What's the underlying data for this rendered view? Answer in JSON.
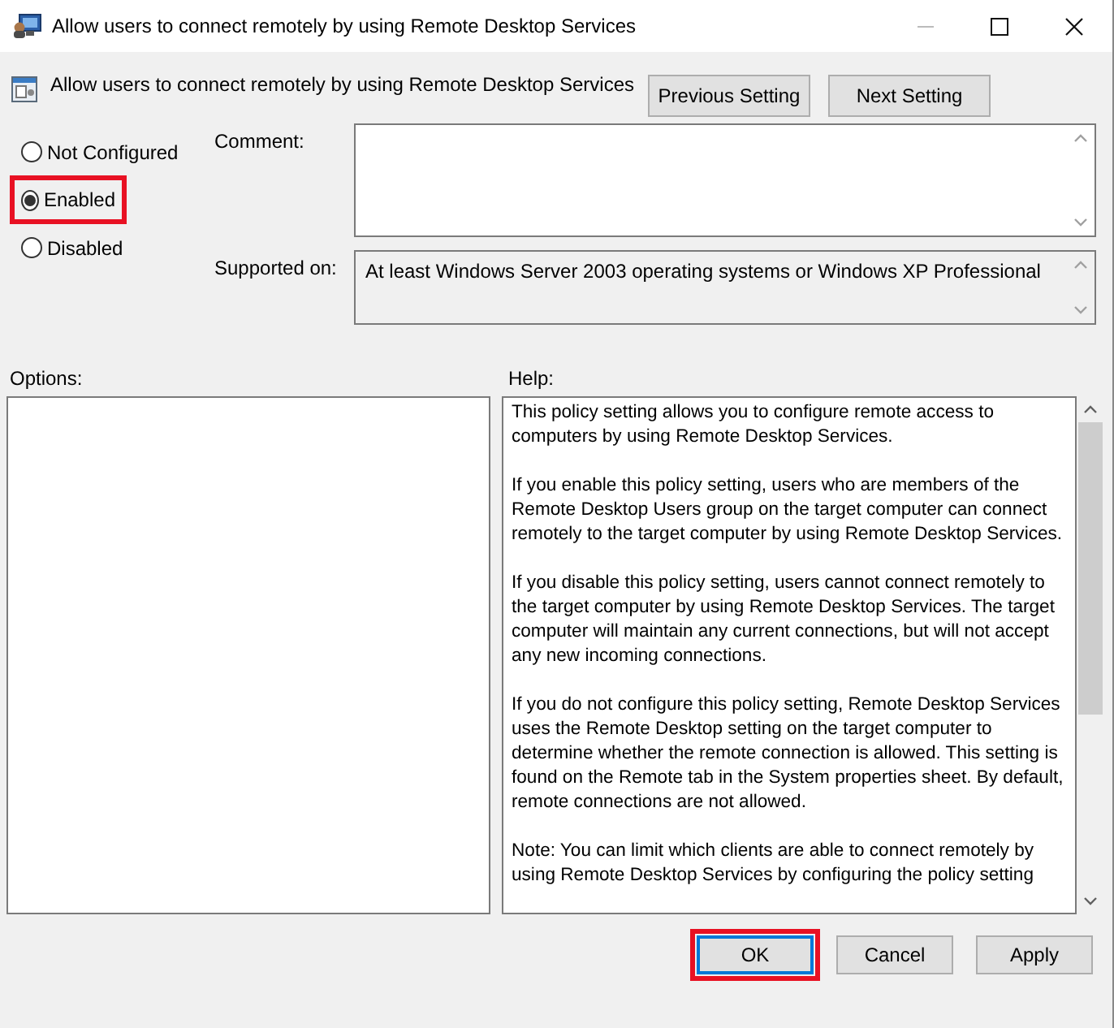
{
  "window": {
    "title": "Allow users to connect remotely by using Remote Desktop Services"
  },
  "header": {
    "title": "Allow users to connect remotely by using Remote Desktop Services",
    "buttons": [
      {
        "label": "Previous Setting"
      },
      {
        "label": "Next Setting"
      }
    ]
  },
  "state_options": [
    {
      "label": "Not Configured",
      "selected": false,
      "highlighted": false
    },
    {
      "label": "Enabled",
      "selected": true,
      "highlighted": true
    },
    {
      "label": "Disabled",
      "selected": false,
      "highlighted": false
    }
  ],
  "comment": {
    "label": "Comment:"
  },
  "supported_on": {
    "label": "Supported on:",
    "value": "At least Windows Server 2003 operating systems or Windows XP Professional"
  },
  "options": {
    "label": "Options:"
  },
  "help": {
    "label": "Help:",
    "paragraphs": [
      "This policy setting allows you to configure remote access to computers by using Remote Desktop Services.",
      "If you enable this policy setting, users who are members of the Remote Desktop Users group on the target computer can connect remotely to the target computer by using Remote Desktop Services.",
      "If you disable this policy setting, users cannot connect remotely to the target computer by using Remote Desktop Services. The target computer will maintain any current connections, but will not accept any new incoming connections.",
      "If you do not configure this policy setting, Remote Desktop Services uses the Remote Desktop setting on the target computer to determine whether the remote connection is allowed. This setting is found on the Remote tab in the System properties sheet. By default, remote connections are not allowed.",
      "Note: You can limit which clients are able to connect remotely by using Remote Desktop Services by configuring the policy setting"
    ]
  },
  "buttons": [
    {
      "label": "OK",
      "focused": true,
      "highlighted": true
    },
    {
      "label": "Cancel",
      "focused": false,
      "highlighted": false
    },
    {
      "label": "Apply",
      "focused": false,
      "highlighted": false
    }
  ]
}
